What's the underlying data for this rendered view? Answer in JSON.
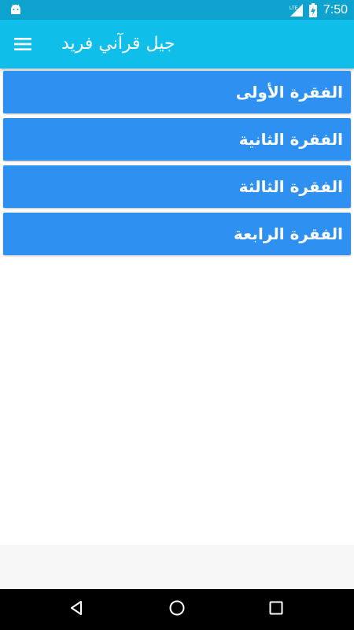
{
  "status_bar": {
    "time": "7:50",
    "network_type": "LTE",
    "icons": [
      "android-icon",
      "lte-signal-icon",
      "battery-charging-icon"
    ]
  },
  "app_bar": {
    "title": "جيل قرآني فريد",
    "menu_icon": "menu-icon"
  },
  "sections": [
    {
      "label": "الفقرة الأولى"
    },
    {
      "label": "الفقرة الثانية"
    },
    {
      "label": "الفقرة الثالثة"
    },
    {
      "label": "الفقرة الرابعة"
    }
  ],
  "nav_bar": {
    "icons": [
      "back-icon",
      "home-icon",
      "recents-icon"
    ]
  },
  "colors": {
    "status_bar": "#0ea2cf",
    "app_bar": "#0fbee9",
    "list_item": "#2e91f2",
    "nav_bar": "#000000"
  }
}
